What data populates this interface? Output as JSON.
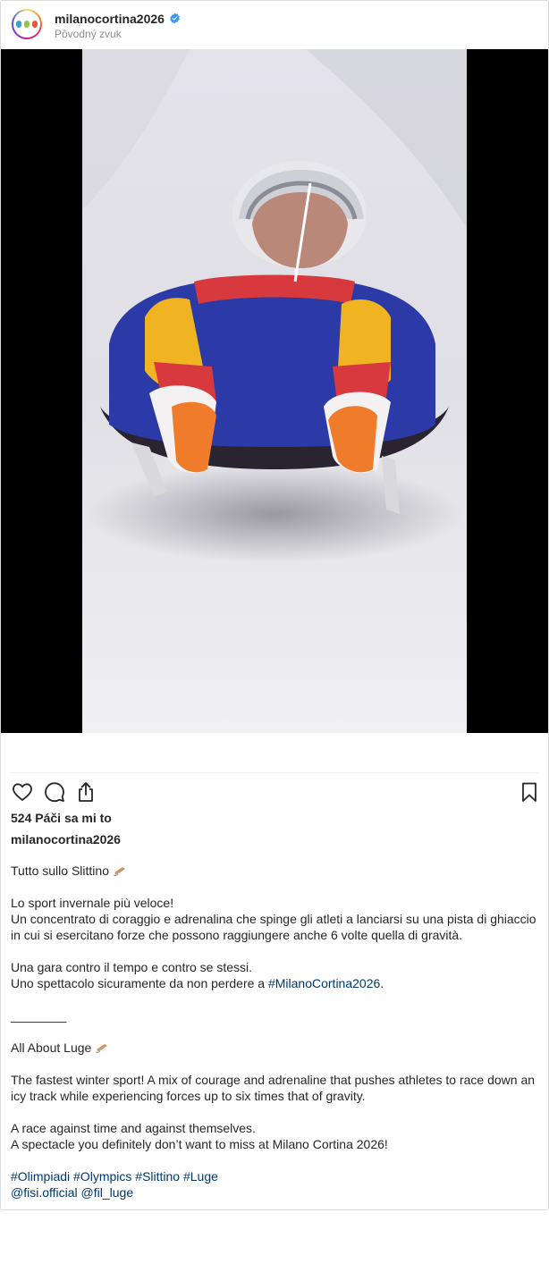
{
  "post": {
    "username": "milanocortina2026",
    "audio": "Pôvodný zvuk",
    "likes": "524 Páči sa mi to",
    "caption_username": "milanocortina2026",
    "caption_it_title": "Tutto sullo Slittino",
    "caption_it_p1_line1": "Lo sport invernale più veloce!",
    "caption_it_p1_line2": "Un concentrato di coraggio e adrenalina che spinge gli atleti a lanciarsi su una pista di ghiaccio in cui si esercitano forze che possono raggiungere anche 6 volte quella di gravità.",
    "caption_it_p2_line1": "Una gara contro il tempo e contro se stessi.",
    "caption_it_p2_line2_prefix": "Uno spettacolo sicuramente da non perdere a",
    "caption_it_hashtag": "#MilanoCortina2026",
    "caption_it_p2_suffix": ".",
    "separator": "________",
    "caption_en_title": "All About Luge",
    "caption_en_p1": "The fastest winter sport! A mix of courage and adrenaline that pushes athletes to race down an icy track while experiencing forces up to six times that of gravity.",
    "caption_en_p2_line1": "A race against time and against themselves.",
    "caption_en_p2_line2": "A spectacle you definitely don’t want to miss at Milano Cortina 2026!",
    "hashtags": [
      "#Olimpiadi",
      "#Olympics",
      "#Slittino",
      "#Luge"
    ],
    "mentions": [
      "@fisi.official",
      "@fil_luge"
    ]
  },
  "icons": {
    "verified": "verified-badge-icon",
    "like": "heart-icon",
    "comment": "comment-icon",
    "share": "share-icon",
    "save": "bookmark-icon",
    "sled": "sled-emoji-icon"
  },
  "colors": {
    "link": "#00376b",
    "verified": "#3897f0",
    "muted": "#8e8e8e",
    "text": "#262626",
    "border": "#dbdbdb"
  }
}
